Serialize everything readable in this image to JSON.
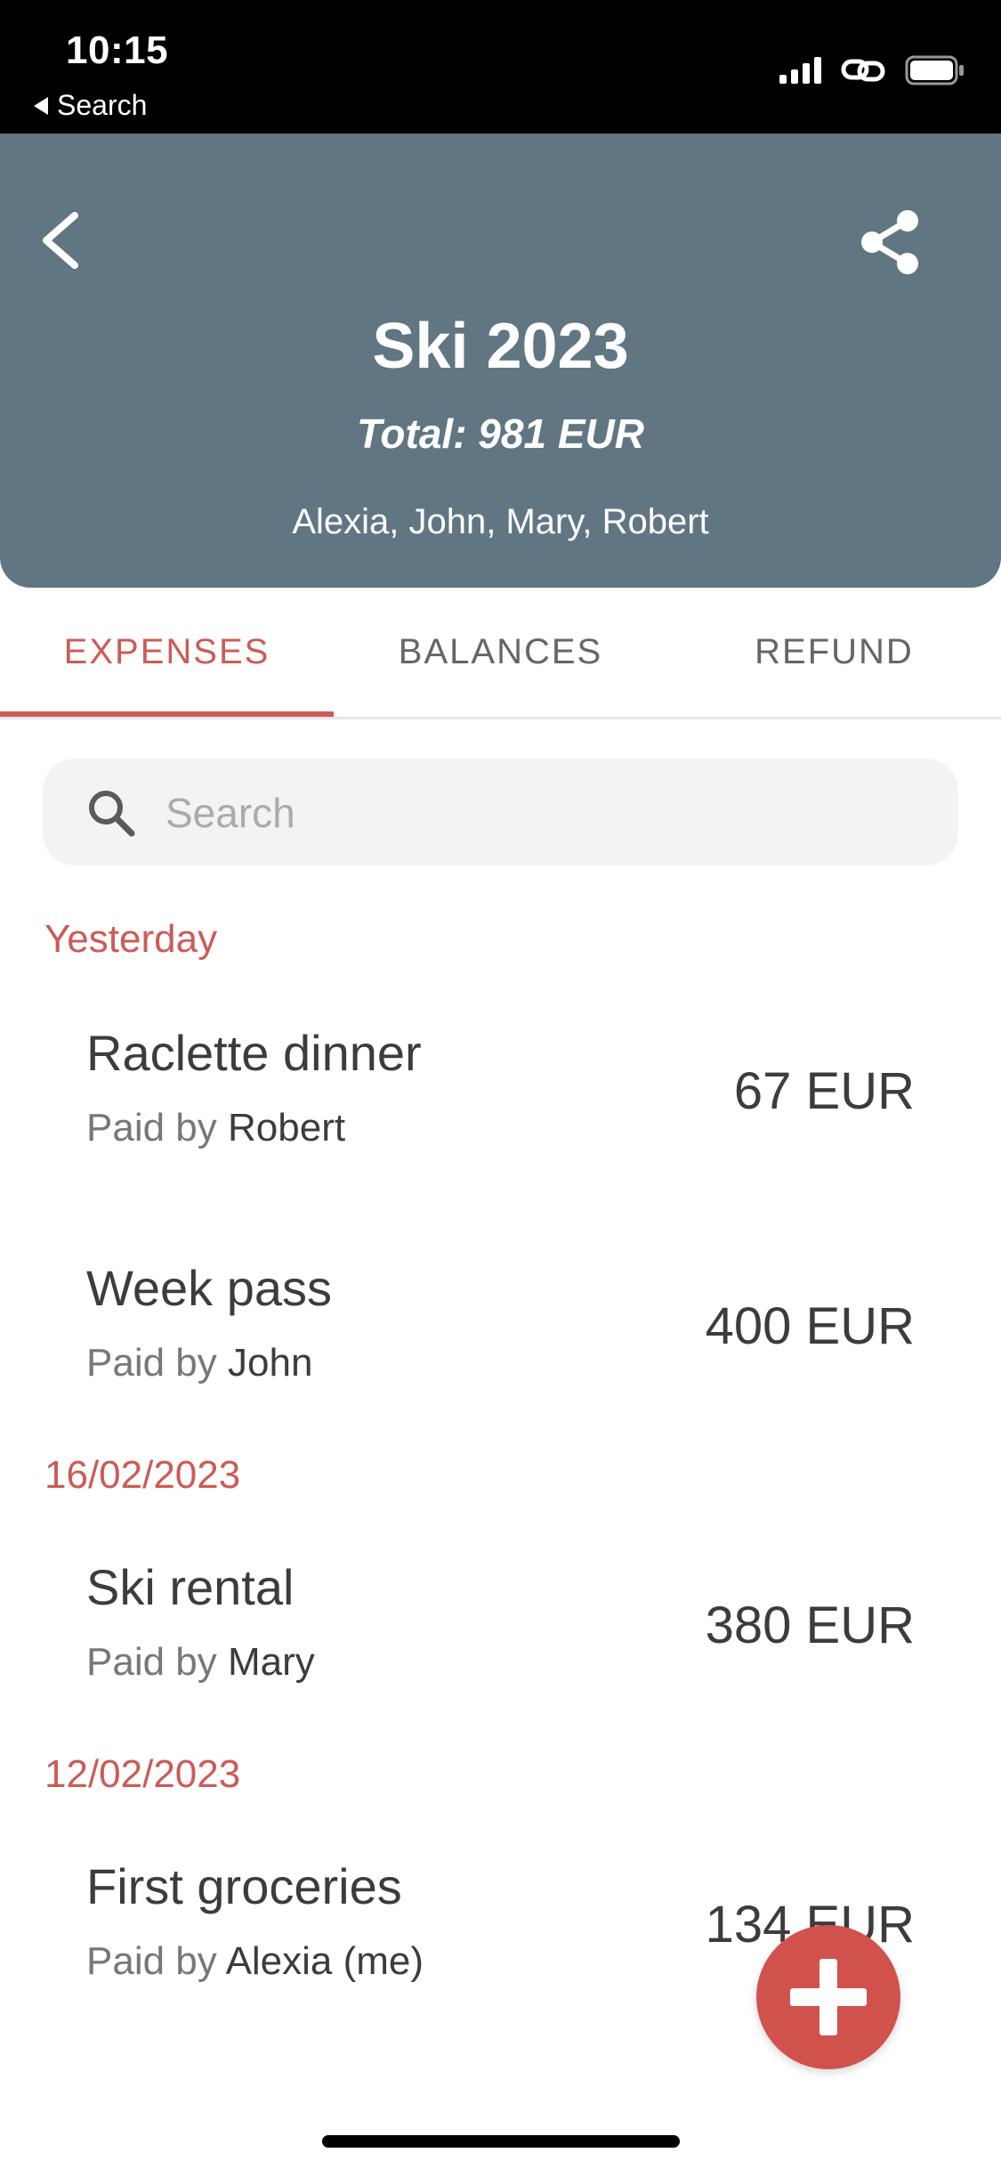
{
  "status_bar": {
    "time": "10:15",
    "back_label": "Search"
  },
  "header": {
    "title": "Ski 2023",
    "total": "Total: 981 EUR",
    "participants": "Alexia, John, Mary, Robert"
  },
  "tabs": [
    {
      "label": "EXPENSES",
      "active": true
    },
    {
      "label": "BALANCES",
      "active": false
    },
    {
      "label": "REFUND",
      "active": false
    }
  ],
  "search": {
    "placeholder": "Search"
  },
  "sections": [
    {
      "label": "Yesterday",
      "items": [
        {
          "title": "Raclette dinner",
          "paid_prefix": "Paid by",
          "payer": "Robert",
          "amount": "67 EUR"
        },
        {
          "title": "Week pass",
          "paid_prefix": "Paid by",
          "payer": "John",
          "amount": "400 EUR"
        }
      ]
    },
    {
      "label": "16/02/2023",
      "items": [
        {
          "title": "Ski rental",
          "paid_prefix": "Paid by",
          "payer": "Mary",
          "amount": "380 EUR"
        }
      ]
    },
    {
      "label": "12/02/2023",
      "items": [
        {
          "title": "First groceries",
          "paid_prefix": "Paid by",
          "payer": "Alexia (me)",
          "amount": "134 EUR"
        }
      ]
    }
  ],
  "colors": {
    "accent": "#cc5b57",
    "header_bg": "#617683",
    "fab": "#d1524d"
  }
}
